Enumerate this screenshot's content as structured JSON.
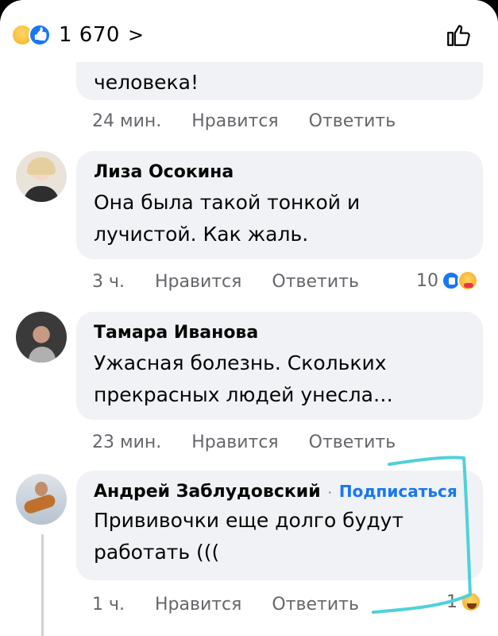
{
  "top_bar": {
    "reaction_count": "1 670",
    "chevron": ">",
    "reaction_icons": [
      "sad-emoji-icon",
      "like-icon"
    ],
    "like_action_icon": "thumbs-up-outline-icon"
  },
  "comments": [
    {
      "author": "",
      "text": "человека!",
      "time": "24 мин.",
      "like_label": "Нравится",
      "reply_label": "Ответить"
    },
    {
      "author": "Лиза Осокина",
      "text": "Она была такой тонкой и лучистой. Как жаль.",
      "time": "3 ч.",
      "like_label": "Нравится",
      "reply_label": "Ответить",
      "reactions_count": "10",
      "reaction_icons": [
        "like-icon",
        "care-icon"
      ]
    },
    {
      "author": "Тамара Иванова",
      "text": "Ужасная болезнь. Скольких прекрасных людей унесла…",
      "time": "23 мин.",
      "like_label": "Нравится",
      "reply_label": "Ответить"
    },
    {
      "author": "Андрей Заблудовский",
      "follow_separator": "·",
      "follow_label": "Подписаться",
      "text": "Прививочки еще долго будут работать (((",
      "time": "1 ч.",
      "like_label": "Нравится",
      "reply_label": "Ответить",
      "reactions_count": "1",
      "reaction_icons": [
        "haha-icon"
      ]
    }
  ],
  "colors": {
    "accent": "#1877f2",
    "bubble": "#f0f2f5",
    "secondary_text": "#65676b",
    "annotation_stroke": "#4fd1d9"
  }
}
